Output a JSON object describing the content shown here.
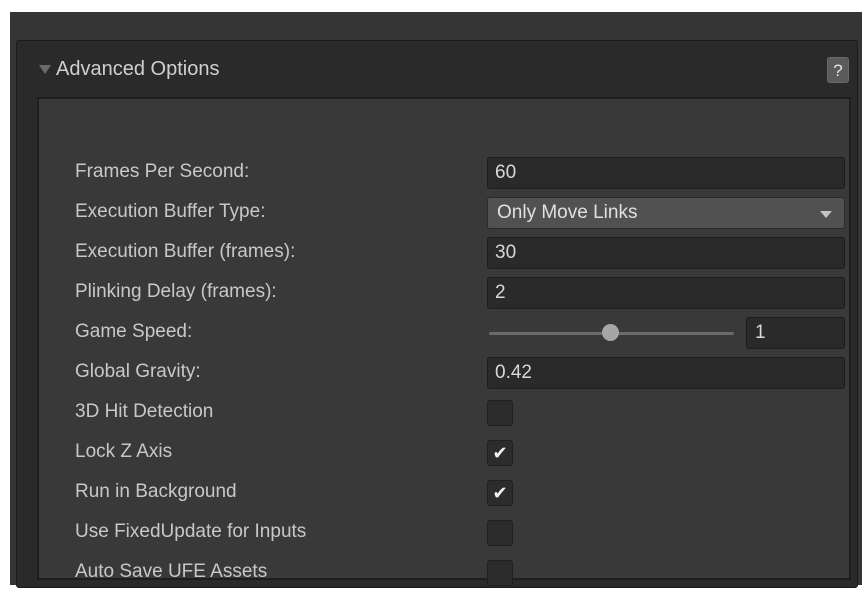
{
  "foldout": {
    "title": "Advanced Options",
    "help_label": "?"
  },
  "fields": {
    "fps": {
      "label": "Frames Per Second:",
      "value": "60"
    },
    "buffer_type": {
      "label": "Execution Buffer Type:",
      "value": "Only Move Links"
    },
    "buffer_frames": {
      "label": "Execution Buffer (frames):",
      "value": "30"
    },
    "plinking": {
      "label": "Plinking Delay (frames):",
      "value": "2"
    },
    "game_speed": {
      "label": "Game Speed:",
      "value": "1",
      "slider_fraction": 0.5
    },
    "gravity": {
      "label": "Global Gravity:",
      "value": "0.42"
    },
    "hit_detection_3d": {
      "label": "3D Hit Detection",
      "checked": false,
      "mark": ""
    },
    "lock_z": {
      "label": "Lock Z Axis",
      "checked": true,
      "mark": "✔"
    },
    "run_background": {
      "label": "Run in Background",
      "checked": true,
      "mark": "✔"
    },
    "fixed_update": {
      "label": "Use FixedUpdate for Inputs",
      "checked": false,
      "mark": ""
    },
    "auto_save": {
      "label": "Auto Save UFE Assets",
      "checked": false,
      "mark": ""
    }
  },
  "icons": {
    "foldout": "triangle-down-icon",
    "dropdown": "chevron-down-icon",
    "check": "checkmark-icon"
  },
  "colors": {
    "background": "#393939",
    "field": "#2a2a2a",
    "dropdown": "#515151",
    "text": "#c8c8c8"
  }
}
